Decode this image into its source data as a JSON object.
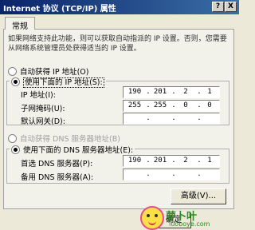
{
  "window": {
    "title": "Internet 协议 (TCP/IP) 属性",
    "help_label": "?",
    "close_label": "X"
  },
  "tabs": [
    {
      "label": "常规"
    }
  ],
  "description": "如果网络支持此功能，则可以获取自动指派的 IP 设置。否则，您需要从网络系统管理员处获得适当的 IP 设置。",
  "ip_section": {
    "auto_label": "自动获得 IP 地址(O)",
    "manual_label": "使用下面的 IP 地址(S):",
    "ip_label": "IP 地址(I):",
    "ip_value": [
      "190",
      "201",
      "2",
      "1"
    ],
    "mask_label": "子网掩码(U):",
    "mask_value": [
      "255",
      "255",
      "0",
      "0"
    ],
    "gateway_label": "默认网关(D):",
    "gateway_value": [
      "",
      "",
      "",
      ""
    ]
  },
  "dns_section": {
    "auto_label": "自动获得 DNS 服务器地址(B)",
    "manual_label": "使用下面的 DNS 服务器地址(E):",
    "preferred_label": "首选 DNS 服务器(P):",
    "preferred_value": [
      "190",
      "201",
      "2",
      "1"
    ],
    "alternate_label": "备用 DNS 服务器(A):",
    "alternate_value": [
      "",
      "",
      "",
      ""
    ]
  },
  "buttons": {
    "advanced_label": "高级(V)...",
    "ok_label": "确定"
  },
  "watermark": {
    "text": "萝卜叶",
    "url": "luoboye.com"
  },
  "colors": {
    "titlebar": "#0a246a",
    "watermark_green": "#2e8b1f"
  }
}
